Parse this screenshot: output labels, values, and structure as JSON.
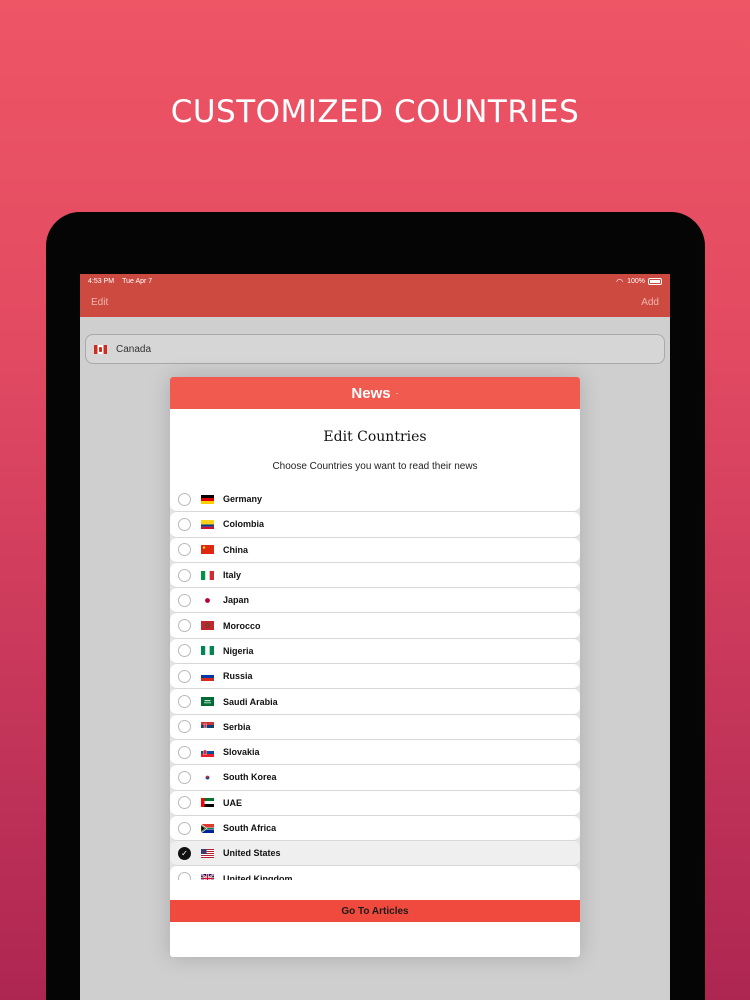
{
  "headline": "CUSTOMIZED COUNTRIES",
  "status_bar": {
    "time": "4:53 PM",
    "date": "Tue Apr 7",
    "battery": "100%"
  },
  "nav": {
    "left": "Edit",
    "right": "Add"
  },
  "saved_country": "Canada",
  "modal": {
    "brand": "News",
    "brand_dot": "·",
    "title": "Edit Countries",
    "subtitle": "Choose Countries you want to read their news",
    "go_button": "Go To Articles"
  },
  "countries": [
    {
      "name": "Germany",
      "flag": "de",
      "selected": false
    },
    {
      "name": "Colombia",
      "flag": "co",
      "selected": false
    },
    {
      "name": "China",
      "flag": "cn",
      "selected": false
    },
    {
      "name": "Italy",
      "flag": "it",
      "selected": false
    },
    {
      "name": "Japan",
      "flag": "jp",
      "selected": false
    },
    {
      "name": "Morocco",
      "flag": "ma",
      "selected": false
    },
    {
      "name": "Nigeria",
      "flag": "ng",
      "selected": false
    },
    {
      "name": "Russia",
      "flag": "ru",
      "selected": false
    },
    {
      "name": "Saudi Arabia",
      "flag": "sa",
      "selected": false
    },
    {
      "name": "Serbia",
      "flag": "rs",
      "selected": false
    },
    {
      "name": "Slovakia",
      "flag": "sk",
      "selected": false
    },
    {
      "name": "South Korea",
      "flag": "kr",
      "selected": false
    },
    {
      "name": "UAE",
      "flag": "ae",
      "selected": false
    },
    {
      "name": "South Africa",
      "flag": "za",
      "selected": false
    },
    {
      "name": "United States",
      "flag": "us",
      "selected": true
    },
    {
      "name": "United Kingdom",
      "flag": "gb",
      "selected": false
    }
  ],
  "colors": {
    "accent": "#f05a4f",
    "nav": "#cc4a40",
    "button": "#ef4a3d"
  }
}
